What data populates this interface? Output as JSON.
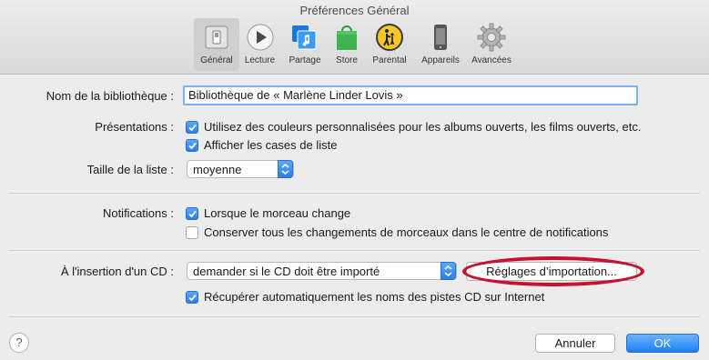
{
  "window": {
    "title": "Préférences Général"
  },
  "toolbar": {
    "items": [
      {
        "label": "Général",
        "icon": "general-switch-icon",
        "selected": true
      },
      {
        "label": "Lecture",
        "icon": "play-icon"
      },
      {
        "label": "Partage",
        "icon": "sharing-icon"
      },
      {
        "label": "Store",
        "icon": "store-bag-icon"
      },
      {
        "label": "Parental",
        "icon": "parental-icon"
      },
      {
        "label": "Appareils",
        "icon": "device-icon"
      },
      {
        "label": "Avancées",
        "icon": "gear-icon"
      }
    ]
  },
  "library": {
    "label": "Nom de la bibliothèque :",
    "value": "Bibliothèque de « Marlène Linder Lovis »"
  },
  "views": {
    "label": "Présentations :",
    "custom_colors": {
      "label": "Utilisez des couleurs personnalisées pour les albums ouverts, les films ouverts, etc.",
      "checked": true
    },
    "show_checkboxes": {
      "label": "Afficher les cases de liste",
      "checked": true
    }
  },
  "list_size": {
    "label": "Taille de la liste :",
    "value": "moyenne"
  },
  "notifications": {
    "label": "Notifications :",
    "song_change": {
      "label": "Lorsque le morceau change",
      "checked": true
    },
    "keep_all": {
      "label": "Conserver tous les changements de morceaux dans le centre de notifications",
      "checked": false
    }
  },
  "cd_insert": {
    "label": "À l'insertion d'un CD :",
    "value": "demander si le CD doit être importé",
    "import_settings_label": "Réglages d’importation...",
    "fetch_names": {
      "label": "Récupérer automatiquement les noms des pistes CD sur Internet",
      "checked": true
    }
  },
  "footer": {
    "help": "?",
    "cancel_label": "Annuler",
    "ok_label": "OK"
  },
  "colors": {
    "accent": "#2a7fe8",
    "highlight_circle": "#c41230"
  }
}
